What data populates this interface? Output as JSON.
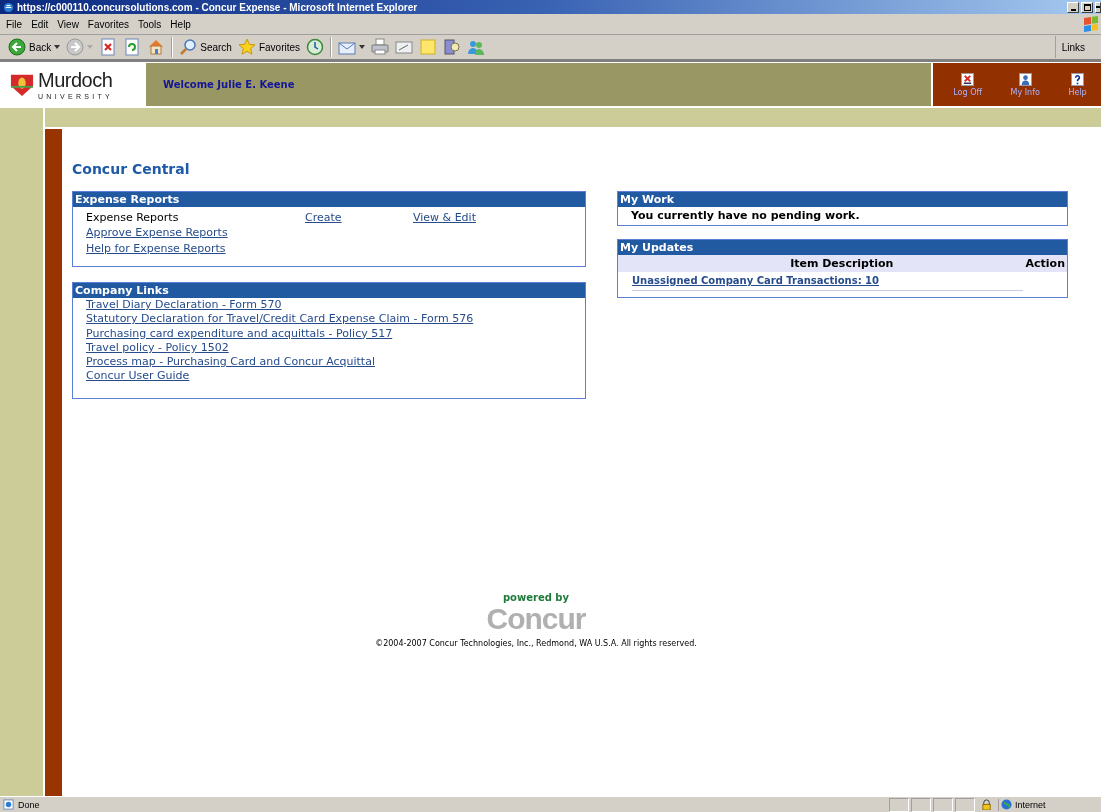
{
  "window": {
    "title": "https://c000110.concursolutions.com - Concur Expense - Microsoft Internet Explorer"
  },
  "menu": [
    "File",
    "Edit",
    "View",
    "Favorites",
    "Tools",
    "Help"
  ],
  "toolbar": {
    "back_label": "Back",
    "search_label": "Search",
    "favorites_label": "Favorites",
    "links_label": "Links"
  },
  "header": {
    "logo_name": "Murdoch",
    "logo_sub": "UNIVERSITY",
    "welcome": "Welcome Julie E. Keene",
    "actions": [
      "Log Off",
      "My Info",
      "Help"
    ]
  },
  "page_title": "Concur Central",
  "expense_reports": {
    "title": "Expense Reports",
    "row_label": "Expense Reports",
    "create": "Create",
    "view_edit": "View & Edit",
    "links": [
      "Approve Expense Reports",
      "Help for Expense Reports"
    ]
  },
  "company_links": {
    "title": "Company Links",
    "links": [
      "Travel Diary Declaration - Form 570",
      "Statutory Declaration for Travel/Credit Card Expense Claim - Form 576",
      "Purchasing card expenditure and acquittals - Policy 517",
      "Travel policy - Policy 1502",
      "Process map - Purchasing Card and Concur Acquittal",
      "Concur User Guide"
    ]
  },
  "my_work": {
    "title": "My Work",
    "message": "You currently have no pending work."
  },
  "my_updates": {
    "title": "My Updates",
    "columns": [
      "Item Description",
      "Action"
    ],
    "rows": [
      {
        "item": "Unassigned Company Card Transactions: 10"
      }
    ]
  },
  "footer": {
    "powered_by": "powered by",
    "logo": "Concur",
    "copyright": "©2004-2007 Concur Technologies, Inc., Redmond, WA U.S.A. All rights reserved."
  },
  "status_bar": {
    "status": "Done",
    "zone": "Internet"
  }
}
